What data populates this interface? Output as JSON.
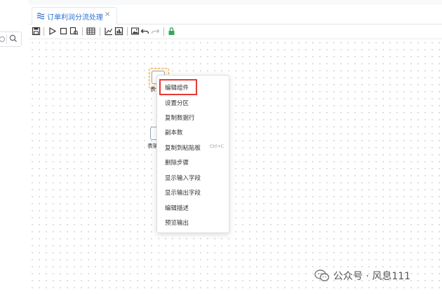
{
  "tab": {
    "title": "订单利润分流处理",
    "close": "×"
  },
  "nodes": [
    {
      "label": "表"
    },
    {
      "label": "表输"
    }
  ],
  "context_menu": {
    "items": [
      {
        "label": "编辑组件",
        "shortcut": "",
        "highlighted": true
      },
      {
        "label": "设置分区",
        "shortcut": ""
      },
      {
        "label": "复制数据行",
        "shortcut": ""
      },
      {
        "label": "副本数",
        "shortcut": ""
      },
      {
        "label": "复制到粘贴板",
        "shortcut": "Ctrl+C"
      },
      {
        "label": "删除步骤",
        "shortcut": ""
      },
      {
        "label": "显示输入字段",
        "shortcut": ""
      },
      {
        "label": "显示输出字段",
        "shortcut": ""
      },
      {
        "label": "编辑描述",
        "shortcut": ""
      },
      {
        "label": "预览输出",
        "shortcut": ""
      }
    ]
  },
  "watermark": {
    "text": "公众号 · 风息111"
  },
  "colors": {
    "accent": "#2b72d6",
    "highlight_frame": "#e53935",
    "selection": "#e89a2d",
    "lock": "#3aa55a"
  }
}
